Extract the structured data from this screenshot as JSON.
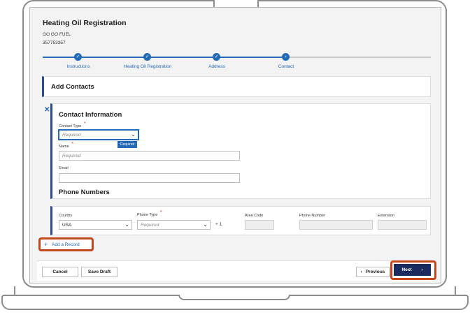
{
  "header": {
    "title": "Heating Oil Registration",
    "org_name": "GO GO FUEL",
    "account_number": "357753357"
  },
  "progress": {
    "steps": [
      {
        "label": "Instructions",
        "state": "complete"
      },
      {
        "label": "Heating Oil Registration",
        "state": "complete"
      },
      {
        "label": "Address",
        "state": "complete"
      },
      {
        "label": "Contact",
        "state": "current"
      }
    ]
  },
  "section": {
    "title": "Add Contacts"
  },
  "contact": {
    "title": "Contact Information",
    "contact_type_label": "Contact Type",
    "contact_type_placeholder": "Required",
    "required_tooltip": "Required",
    "name_label": "Name",
    "name_placeholder": "Required",
    "email_label": "Email",
    "email_value": "",
    "phone_section_title": "Phone Numbers"
  },
  "phone": {
    "country_label": "Country",
    "country_value": "USA",
    "phone_type_label": "Phone Type",
    "phone_type_placeholder": "Required",
    "country_code": "+ 1",
    "area_code_label": "Area Code",
    "phone_number_label": "Phone Number",
    "extension_label": "Extension"
  },
  "actions": {
    "add_record_label": "Add a Record",
    "cancel_label": "Cancel",
    "save_draft_label": "Save Draft",
    "previous_label": "Previous",
    "next_label": "Next"
  },
  "colors": {
    "accent": "#2469b3",
    "navy": "#1b2a5e",
    "highlight": "#c5451c"
  },
  "icons": {
    "check": "check-icon",
    "arrow": "arrow-right-icon",
    "close": "close-icon",
    "plus": "plus-icon",
    "chevron_down": "chevron-down-icon",
    "chevron_left": "chevron-left-icon",
    "chevron_right": "chevron-right-icon"
  }
}
